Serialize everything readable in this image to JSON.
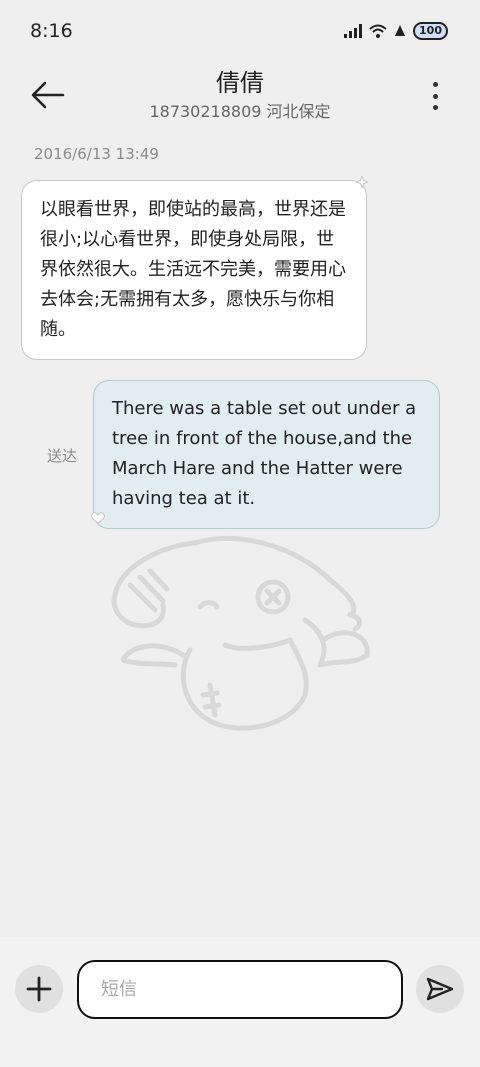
{
  "status_bar": {
    "time": "8:16",
    "battery": "100"
  },
  "header": {
    "contact_name": "倩倩",
    "contact_subtitle": "18730218809 河北保定"
  },
  "conversation": {
    "timestamp": "2016/6/13 13:49",
    "messages": [
      {
        "direction": "incoming",
        "text": "以眼看世界，即使站的最高，世界还是很小;以心看世界，即使身处局限，世界依然很大。生活远不完美，需要用心去体会;无需拥有太多，愿快乐与你相随。"
      },
      {
        "direction": "outgoing",
        "text": "There was a table set out under a tree in front of the house,and the March Hare and the Hatter were having tea at it.",
        "status": "送达"
      }
    ]
  },
  "composer": {
    "placeholder": "短信"
  },
  "icons": {
    "back": "arrow-left-icon",
    "more": "more-vertical-icon",
    "add": "plus-icon",
    "send": "send-icon"
  },
  "colors": {
    "background": "#efeff0",
    "incoming_bubble": "#ffffff",
    "outgoing_bubble": "#e1edf0"
  }
}
